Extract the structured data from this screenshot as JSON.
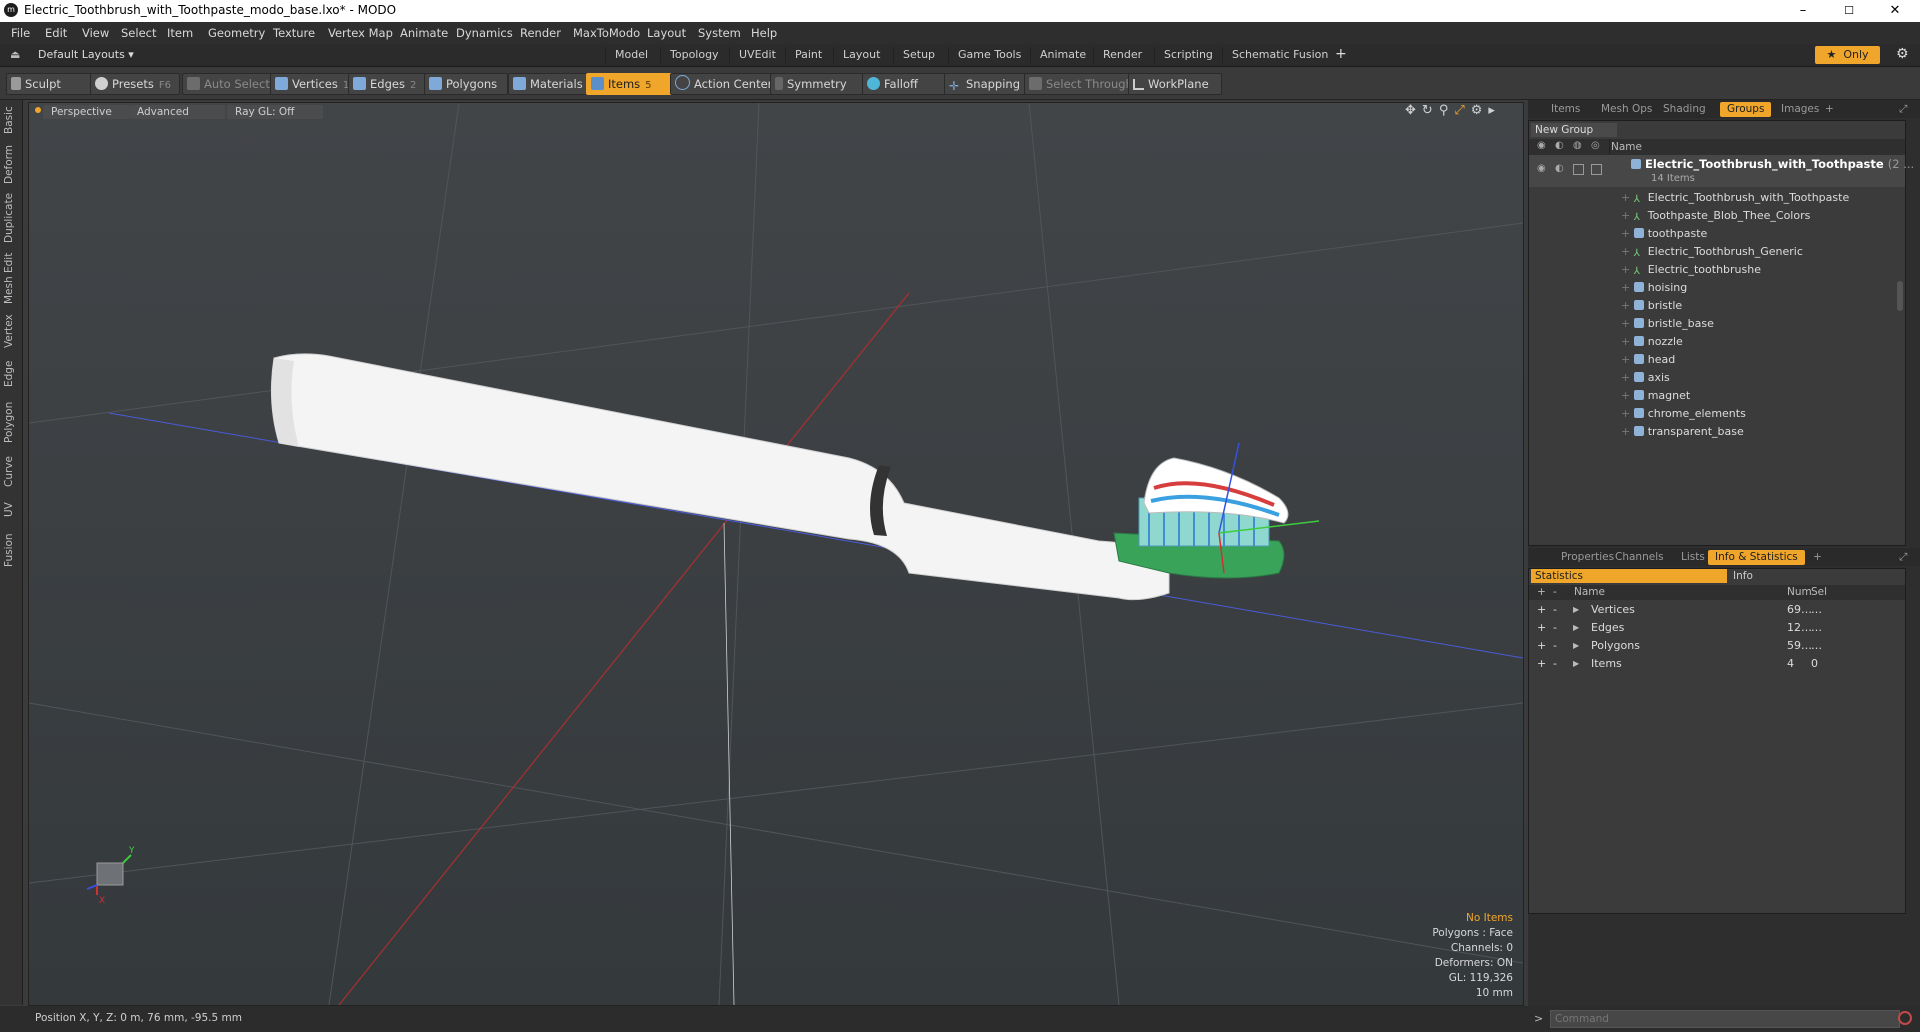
{
  "window": {
    "title": "Electric_Toothbrush_with_Toothpaste_modo_base.lxo* - MODO",
    "app_icon": "modo-logo",
    "minimize": "–",
    "maximize": "☐",
    "close": "✕"
  },
  "menu": [
    "File",
    "Edit",
    "View",
    "Select",
    "Item",
    "Geometry",
    "Texture",
    "Vertex Map",
    "Animate",
    "Dynamics",
    "Render",
    "MaxToModo",
    "Layout",
    "System",
    "Help"
  ],
  "layoutbar": {
    "layout_selector": "Default Layouts ▾",
    "tabs": [
      "Model",
      "Topology",
      "UVEdit",
      "Paint",
      "Layout",
      "Setup",
      "Game Tools",
      "Animate",
      "Render",
      "Scripting",
      "Schematic Fusion"
    ],
    "active_tab": "Model",
    "add": "+",
    "only_label": "Only",
    "only_star": "★",
    "gear": "⚙"
  },
  "toolbar": {
    "sculpt": "Sculpt",
    "presets": "Presets",
    "presets_key": "F6",
    "auto_select": "Auto Select",
    "vertices": "Vertices",
    "vertices_key": "1",
    "edges": "Edges",
    "edges_key": "2",
    "polygons": "Polygons",
    "materials": "Materials",
    "items": "Items",
    "items_key": "5",
    "action_center": "Action Center",
    "symmetry": "Symmetry",
    "falloff": "Falloff",
    "snapping": "Snapping",
    "select_through": "Select Through",
    "workplane": "WorkPlane"
  },
  "left_tabs": [
    "Basic",
    "Deform",
    "Duplicate",
    "Mesh Edit",
    "Vertex",
    "Edge",
    "Polygon",
    "Curve",
    "UV",
    "Fusion"
  ],
  "viewport": {
    "view_mode": "Perspective",
    "shading": "Advanced",
    "raygl": "Ray GL: Off",
    "info": {
      "items": "No Items",
      "polygons": "Polygons : Face",
      "channels": "Channels: 0",
      "deformers": "Deformers: ON",
      "gl": "GL: 119,326",
      "scale": "10 mm"
    },
    "axis_labels": {
      "y": "Y",
      "x": "X"
    }
  },
  "status": {
    "position": "Position X, Y, Z:  0 m, 76 mm, -95.5 mm"
  },
  "groups_panel": {
    "tabs": [
      "Items",
      "Mesh Ops",
      "Shading",
      "Groups",
      "Images"
    ],
    "active_tab": "Groups",
    "add": "+",
    "new_group": "New Group",
    "column_name": "Name",
    "group_name": "Electric_Toothbrush_with_Toothpaste",
    "group_suffix": "(2 ...",
    "group_count": "14 Items",
    "items": [
      {
        "name": "Electric_Toothbrush_with_Toothpaste",
        "icon": "locator-icon"
      },
      {
        "name": "Toothpaste_Blob_Thee_Colors",
        "icon": "locator-icon"
      },
      {
        "name": "toothpaste",
        "icon": "mesh-icon"
      },
      {
        "name": "Electric_Toothbrush_Generic",
        "icon": "locator-icon"
      },
      {
        "name": "Electric_toothbrushe",
        "icon": "locator-icon"
      },
      {
        "name": "hoising",
        "icon": "mesh-icon"
      },
      {
        "name": "bristle",
        "icon": "mesh-icon"
      },
      {
        "name": "bristle_base",
        "icon": "mesh-icon"
      },
      {
        "name": "nozzle",
        "icon": "mesh-icon"
      },
      {
        "name": "head",
        "icon": "mesh-icon"
      },
      {
        "name": "axis",
        "icon": "mesh-icon"
      },
      {
        "name": "magnet",
        "icon": "mesh-icon"
      },
      {
        "name": "chrome_elements",
        "icon": "mesh-icon"
      },
      {
        "name": "transparent_base",
        "icon": "mesh-icon"
      }
    ]
  },
  "stats_panel": {
    "tabs": [
      "Properties",
      "Channels",
      "Lists",
      "Info & Statistics"
    ],
    "active_tab": "Info & Statistics",
    "add": "+",
    "subtabs": [
      "Statistics",
      "Info"
    ],
    "columns": {
      "plus": "+",
      "minus": "-",
      "name": "Name",
      "num": "Num",
      "sel": "Sel"
    },
    "rows": [
      {
        "name": "Vertices",
        "num": "69…",
        "sel": "…"
      },
      {
        "name": "Edges",
        "num": "12…",
        "sel": "…"
      },
      {
        "name": "Polygons",
        "num": "59…",
        "sel": "…"
      },
      {
        "name": "Items",
        "num": "4",
        "sel": "0"
      }
    ]
  },
  "command": {
    "placeholder": "Command",
    "prompt": ">"
  },
  "colors": {
    "accent": "#f0a62b",
    "panel": "#3b3b3b",
    "viewport": "#3a3e41"
  }
}
